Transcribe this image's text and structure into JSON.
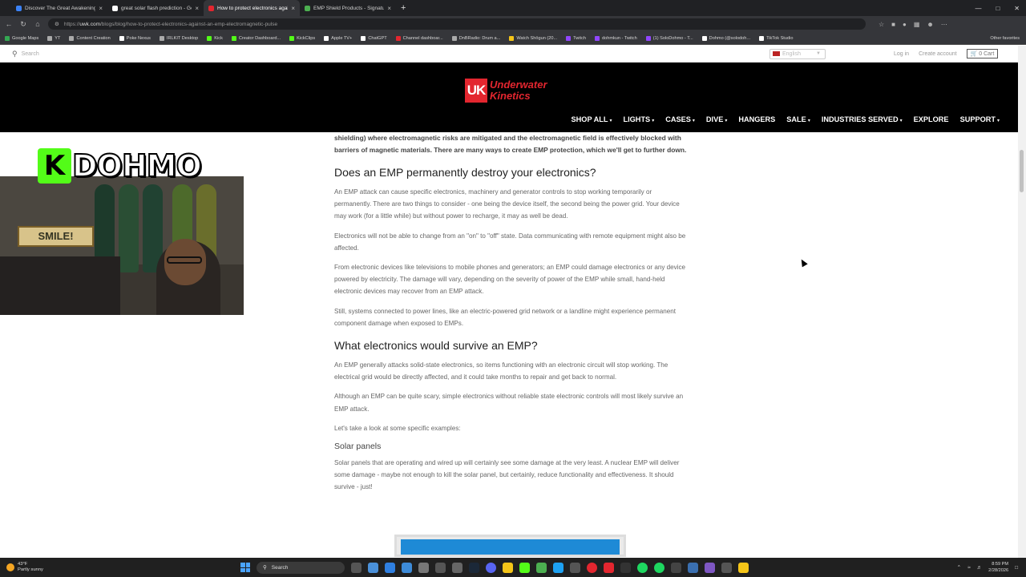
{
  "browser": {
    "tabs": [
      {
        "label": "Discover The Great Awakening Ma",
        "color": "#3b82f6",
        "active": false
      },
      {
        "label": "great solar flash prediction - Goog",
        "color": "#ffffff",
        "active": false
      },
      {
        "label": "How to protect electronics against",
        "color": "#e3262f",
        "active": true
      },
      {
        "label": "EMP Shield Products - Signature S",
        "color": "#4caf50",
        "active": false
      }
    ],
    "new_tab": "+",
    "url_host": "uwk.com",
    "url_path": "/blogs/blog/how-to-protect-electronics-against-an-emp-electromagnetic-pulse",
    "url_prefix": "https://",
    "bookmarks": [
      {
        "label": "Google Maps",
        "color": "#34a853"
      },
      {
        "label": "YT",
        "color": "#aaaaaa"
      },
      {
        "label": "Content Creation",
        "color": "#aaaaaa"
      },
      {
        "label": "Poke Nexus",
        "color": "#ffffff"
      },
      {
        "label": "IRLKIT Desktop",
        "color": "#aaaaaa"
      },
      {
        "label": "Kick",
        "color": "#53fc18"
      },
      {
        "label": "Creator Dashboard...",
        "color": "#53fc18"
      },
      {
        "label": "KickClips",
        "color": "#53fc18"
      },
      {
        "label": "Apple TV+",
        "color": "#ffffff"
      },
      {
        "label": "ChatGPT",
        "color": "#ffffff"
      },
      {
        "label": "Channel dashboar...",
        "color": "#e3262f"
      },
      {
        "label": "DnBRadio: Drum a...",
        "color": "#aaaaaa"
      },
      {
        "label": "Watch Shōgun (20...",
        "color": "#f5c518"
      },
      {
        "label": "Twitch",
        "color": "#9146ff"
      },
      {
        "label": "dohmkun - Twitch",
        "color": "#9146ff"
      },
      {
        "label": "(1) SoloDohmo - T...",
        "color": "#9146ff"
      },
      {
        "label": "Dohmo (@solodoh...",
        "color": "#ffffff"
      },
      {
        "label": "TikTok Studio",
        "color": "#ffffff"
      }
    ],
    "other_favorites": "Other favorites"
  },
  "site": {
    "search_placeholder": "Search",
    "language": "English",
    "login": "Log in",
    "create_account": "Create account",
    "cart": "0 Cart",
    "logo_mark": "UK",
    "logo_line1": "Underwater",
    "logo_line2": "Kinetics",
    "nav": [
      {
        "label": "SHOP ALL",
        "dropdown": true
      },
      {
        "label": "LIGHTS",
        "dropdown": true
      },
      {
        "label": "CASES",
        "dropdown": true
      },
      {
        "label": "DIVE",
        "dropdown": true
      },
      {
        "label": "HANGERS",
        "dropdown": false
      },
      {
        "label": "SALE",
        "dropdown": true
      },
      {
        "label": "INDUSTRIES SERVED",
        "dropdown": true
      },
      {
        "label": "EXPLORE",
        "dropdown": false
      },
      {
        "label": "SUPPORT",
        "dropdown": true
      }
    ]
  },
  "article": {
    "lead": "shielding) where electromagnetic risks are mitigated and the electromagnetic field is effectively blocked with barriers of magnetic materials. There are many ways to create EMP protection, which we'll get to further down.",
    "h2_1": "Does an EMP permanently destroy your electronics?",
    "p1": "An EMP attack can cause specific electronics, machinery and generator controls to stop working temporarily or permanently. There are two things to consider - one being the device itself, the second being the power grid. Your device may work (for a little while) but without power to recharge, it may as well be dead.",
    "p2": "Electronics will not be able to change from an \"on\" to \"off\" state. Data communicating with remote equipment might also be affected.",
    "p3": "From electronic devices like televisions to mobile phones and generators; an EMP could damage electronics or any device powered by electricity. The damage will vary, depending on the severity of power of the EMP while small, hand-held electronic devices may recover from an EMP attack.",
    "p4": "Still, systems connected to power lines, like an electric-powered grid network or a landline might experience permanent component damage when exposed to EMPs.",
    "h2_2": "What electronics would survive an EMP?",
    "p5": "An EMP generally attacks solid-state electronics, so items functioning with an electronic circuit will stop working. The electrical grid would be directly affected, and it could take months to repair and get back to normal.",
    "p6": "Although an EMP can be quite scary, simple electronics without reliable state electronic controls will most likely survive an EMP attack.",
    "p7": "Let's take a look at some specific examples:",
    "h3_1": "Solar panels",
    "p8": "Solar panels that are operating and wired up will certainly see some damage at the very least. A nuclear EMP will deliver some damage - maybe not enough to kill the solar panel, but certainly, reduce functionality and effectiveness. It should survive - just!"
  },
  "overlay": {
    "channel_name": "DOHMO",
    "logo_letter": "K",
    "sign_text": "SMILE!"
  },
  "taskbar": {
    "weather_temp": "43°F",
    "weather_desc": "Partly sunny",
    "search": "Search",
    "time": "8:59 PM",
    "date": "2/28/2026"
  }
}
